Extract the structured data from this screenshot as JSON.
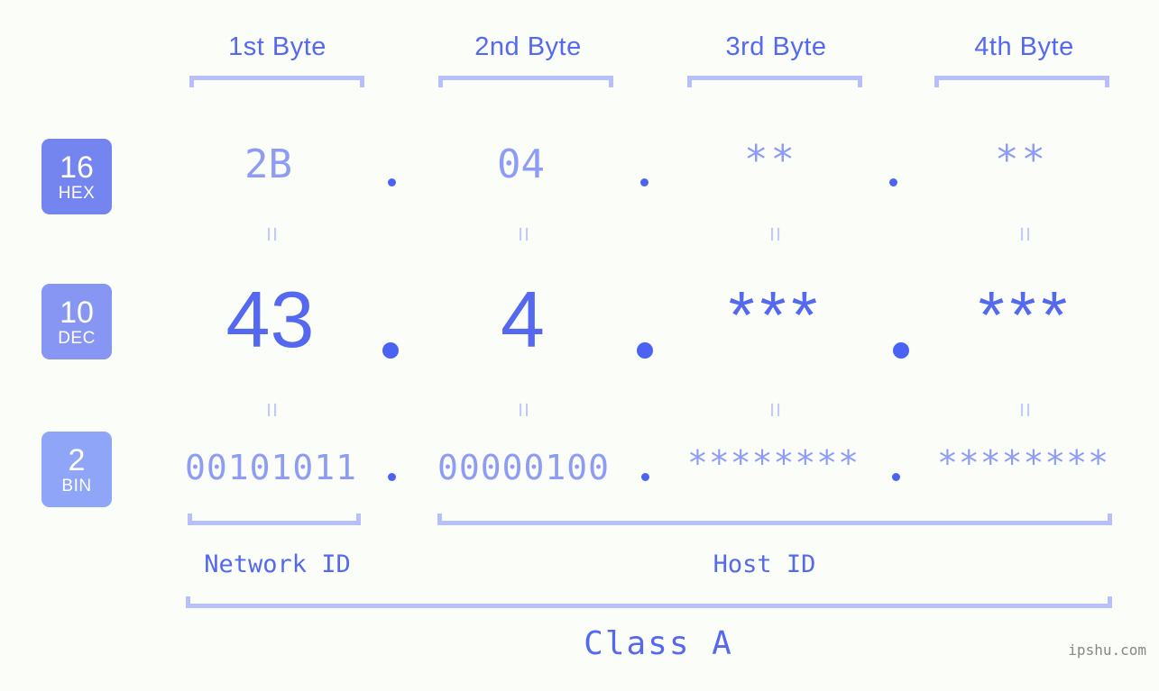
{
  "page": {
    "background": "#fbfdf8",
    "accent_strong": "#5468f0",
    "accent_mid": "#8e9cf6",
    "accent_light": "#b7c0fb",
    "watermark": "ipshu.com"
  },
  "byte_headers": [
    {
      "label": "1st Byte"
    },
    {
      "label": "2nd Byte"
    },
    {
      "label": "3rd Byte"
    },
    {
      "label": "4th Byte"
    }
  ],
  "bases": [
    {
      "number": "16",
      "name": "HEX",
      "color": "#7585ef"
    },
    {
      "number": "10",
      "name": "DEC",
      "color": "#8795f3"
    },
    {
      "number": "2",
      "name": "BIN",
      "color": "#8ea5f8"
    }
  ],
  "rows": {
    "hex": {
      "base_number": "16",
      "base_name": "HEX",
      "values": [
        "2B",
        "04",
        "**",
        "**"
      ],
      "separator": "."
    },
    "dec": {
      "base_number": "10",
      "base_name": "DEC",
      "values": [
        "43",
        "4",
        "***",
        "***"
      ],
      "separator": "."
    },
    "bin": {
      "base_number": "2",
      "base_name": "BIN",
      "values": [
        "00101011",
        "00000100",
        "********",
        "********"
      ],
      "separator": "."
    }
  },
  "equals_symbol": "=",
  "sections": [
    {
      "label": "Network ID"
    },
    {
      "label": "Host ID"
    }
  ],
  "class": {
    "label": "Class A"
  }
}
